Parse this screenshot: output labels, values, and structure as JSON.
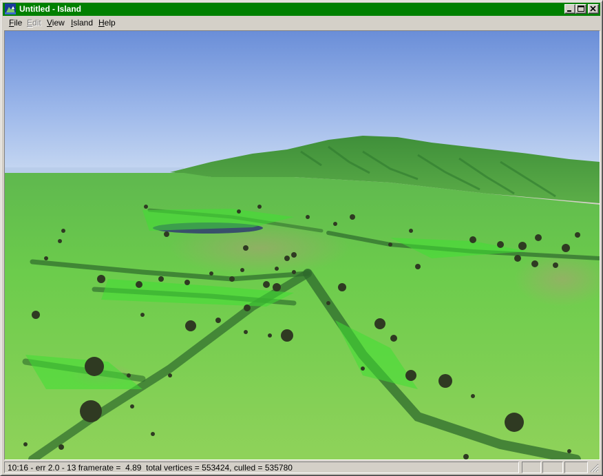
{
  "window": {
    "title": "Untitled - Island",
    "title_bar_color": "#008000",
    "app_icon": "island-app-icon",
    "controls": {
      "minimize_icon": "minimize-icon",
      "maximize_icon": "maximize-icon",
      "close_icon": "close-icon"
    }
  },
  "menubar": {
    "items": [
      {
        "label": "File",
        "enabled": true
      },
      {
        "label": "Edit",
        "enabled": false
      },
      {
        "label": "View",
        "enabled": true
      },
      {
        "label": "Island",
        "enabled": true
      },
      {
        "label": "Help",
        "enabled": true
      }
    ]
  },
  "viewport": {
    "content": "3d-terrain-render",
    "sky_color_top": "#6a8ed8",
    "sky_color_horizon": "#c4d6f2",
    "terrain_color": "#5cc34a",
    "mountain_color": "#4a9a3c",
    "lake_color": "#39506b"
  },
  "statusbar": {
    "text": "10:16 - err 2.0 - 13 framerate =  4.89  total vertices = 553424, culled = 535780",
    "resize_grip_icon": "resize-grip-icon"
  }
}
